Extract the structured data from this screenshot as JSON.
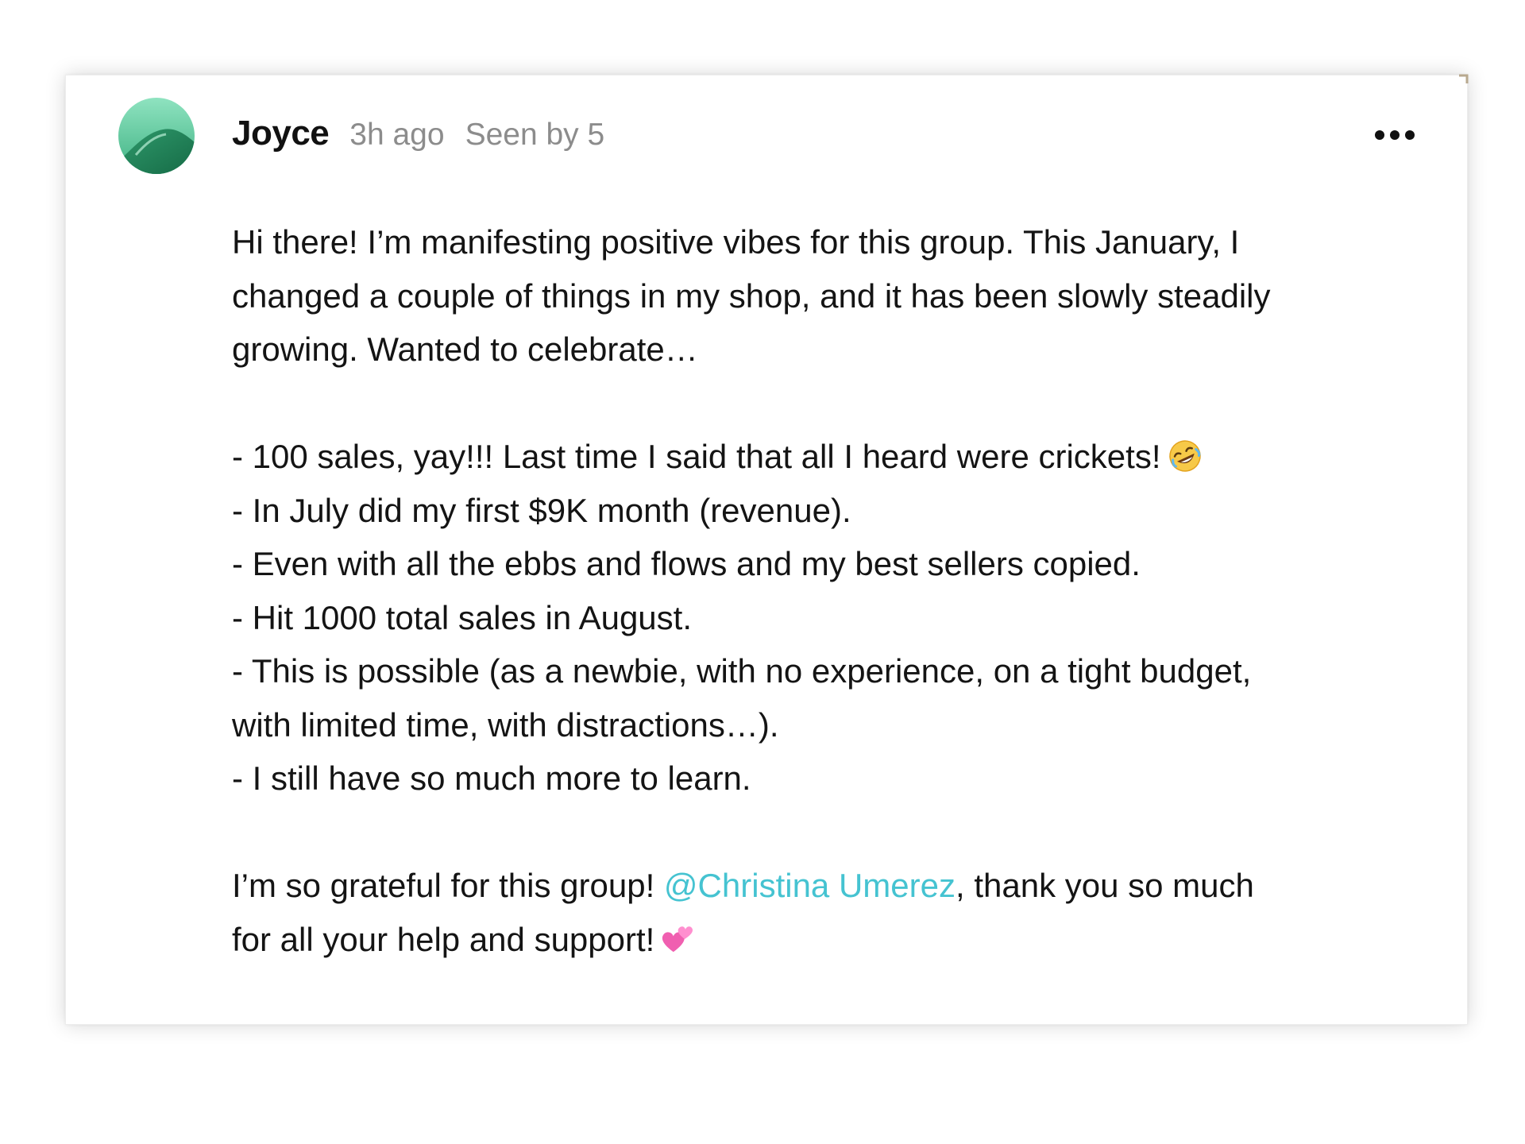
{
  "post": {
    "author": "Joyce",
    "time_ago": "3h ago",
    "seen_by": "Seen by 5",
    "more_icon": "more-horizontal-icon",
    "avatar_colors": [
      "#7fd9b4",
      "#2fa676",
      "#1b7a52"
    ],
    "body": {
      "line1": "Hi there! I’m manifesting positive vibes for this group. This January, I",
      "line2": "changed a couple of things in my shop, and it has been slowly steadily",
      "line3": "growing. Wanted to celebrate…",
      "bullet1": "- 100 sales, yay!!! Last time I said that all I heard were crickets!",
      "bullet1_emoji": "rolling-on-floor-laughing-emoji",
      "bullet2": "- In July did my first $9K month (revenue).",
      "bullet3": "- Even with all the ebbs and flows and my best sellers copied.",
      "bullet4": "- Hit 1000 total sales in August.",
      "bullet5a": "- This is possible (as a newbie, with no experience, on a tight budget,",
      "bullet5b": "with limited time, with distractions…).",
      "bullet6": "- I still have so much more to learn.",
      "closing_prefix": "I’m so grateful for this group! ",
      "mention": "@Christina Umerez",
      "closing_suffix": ", thank you so much",
      "closing_line2": "for all your help and support!",
      "closing_emoji": "two-hearts-emoji"
    },
    "mention_color": "#45c3d1"
  }
}
